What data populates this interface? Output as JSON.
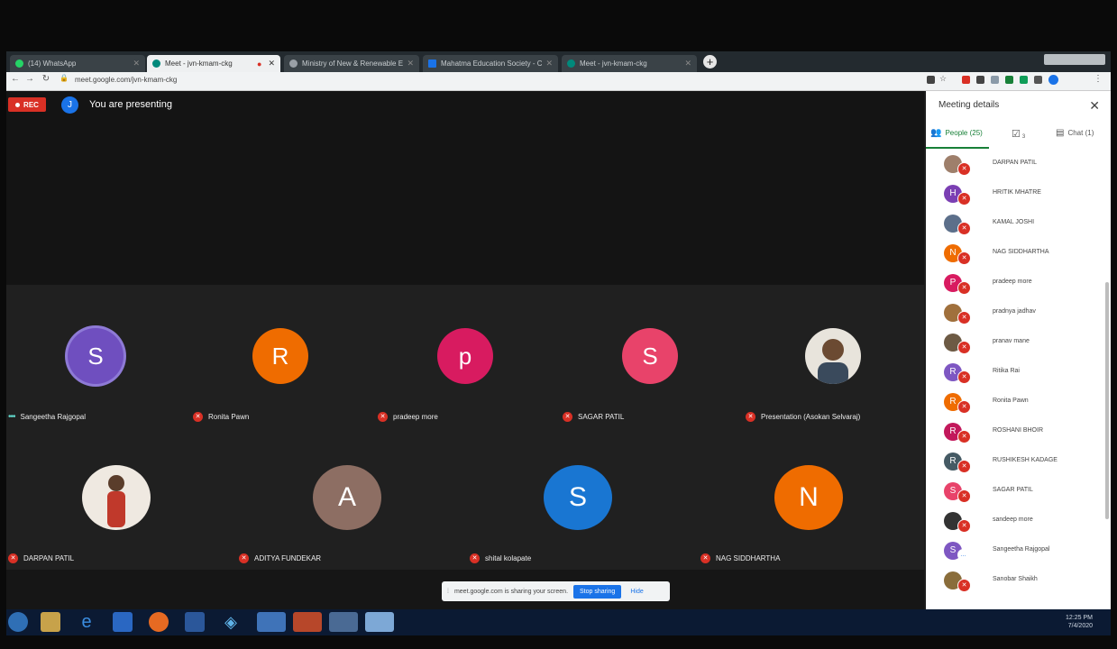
{
  "browser": {
    "tabs": [
      {
        "label": "(14) WhatsApp",
        "icon_color": "#25d366"
      },
      {
        "label": "Meet - jvn-kmam-ckg",
        "icon_color": "#00897b"
      },
      {
        "label": "Ministry of New & Renewable E...",
        "icon_color": "#9aa0a6"
      },
      {
        "label": "Mahatma Education Society - C...",
        "icon_color": "#1a73e8"
      },
      {
        "label": "Meet - jvn-kmam-ckg",
        "icon_color": "#00897b"
      }
    ],
    "new_tab": "+",
    "url": "meet.google.com/jvn-kmam-ckg"
  },
  "meet": {
    "rec_label": "REC",
    "presenter_initial": "J",
    "presenting_text": "You are presenting",
    "tiles": [
      {
        "initial": "S",
        "color": "#6f4fbf",
        "name": "Sangeetha Rajgopal",
        "speaking": true
      },
      {
        "initial": "R",
        "color": "#ef6c00",
        "name": "Ronita Pawn",
        "speaking": false
      },
      {
        "initial": "p",
        "color": "#d81b60",
        "name": "pradeep more",
        "speaking": false
      },
      {
        "initial": "S",
        "color": "#e8436a",
        "name": "SAGAR PATIL",
        "speaking": false
      },
      {
        "initial": "",
        "color": "#e8e4dc",
        "name": "Presentation (Asokan Selvaraj)",
        "speaking": false,
        "photo": true
      },
      {
        "initial": "",
        "color": "#efe9e1",
        "name": "DARPAN PATIL",
        "speaking": false,
        "photo": true
      },
      {
        "initial": "A",
        "color": "#8d6e63",
        "name": "ADITYA FUNDEKAR",
        "speaking": false
      },
      {
        "initial": "S",
        "color": "#1976d2",
        "name": "shital kolapate",
        "speaking": false
      },
      {
        "initial": "N",
        "color": "#ef6c00",
        "name": "NAG SIDDHARTHA",
        "speaking": false
      }
    ],
    "share_bar": {
      "text": "meet.google.com is sharing your screen.",
      "stop_label": "Stop sharing",
      "hide_label": "Hide"
    }
  },
  "panel": {
    "title": "Meeting details",
    "tabs": {
      "people": "People (25)",
      "tasks_count": "3",
      "chat": "Chat (1)"
    },
    "people": [
      {
        "name": "DARPAN PATIL",
        "initial": "",
        "color": "#9e7f6b"
      },
      {
        "name": "HRITIK MHATRE",
        "initial": "H",
        "color": "#7b3fb3"
      },
      {
        "name": "KAMAL JOSHI",
        "initial": "",
        "color": "#5c6f8a"
      },
      {
        "name": "NAG SIDDHARTHA",
        "initial": "N",
        "color": "#ef6c00"
      },
      {
        "name": "pradeep more",
        "initial": "P",
        "color": "#d81b60"
      },
      {
        "name": "pradnya jadhav",
        "initial": "",
        "color": "#a0703c"
      },
      {
        "name": "pranav mane",
        "initial": "",
        "color": "#6d5a44"
      },
      {
        "name": "Ritika Rai",
        "initial": "R",
        "color": "#7e57c2"
      },
      {
        "name": "Ronita Pawn",
        "initial": "R",
        "color": "#ef6c00"
      },
      {
        "name": "ROSHANI BHOIR",
        "initial": "R",
        "color": "#c2185b"
      },
      {
        "name": "RUSHIKESH KADAGE",
        "initial": "R",
        "color": "#455a64"
      },
      {
        "name": "SAGAR PATIL",
        "initial": "S",
        "color": "#e8436a"
      },
      {
        "name": "sandeep more",
        "initial": "",
        "color": "#333333"
      },
      {
        "name": "Sangeetha Rajgopal",
        "initial": "S",
        "color": "#7e57c2"
      },
      {
        "name": "Sanobar Shaikh",
        "initial": "",
        "color": "#8a6d3b"
      }
    ]
  },
  "taskbar": {
    "time": "12:25 PM",
    "date": "7/4/2020"
  }
}
